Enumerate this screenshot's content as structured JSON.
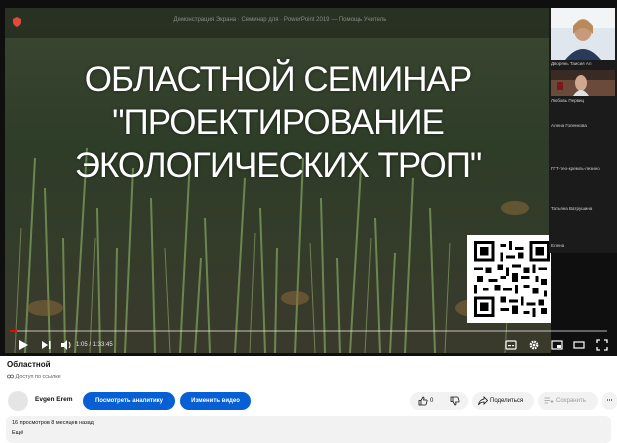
{
  "video": {
    "slide_title_lines": [
      "ОБЛАСТНОЙ СЕМИНАР",
      "\"ПРОЕКТИРОВАНИЕ",
      "ЭКОЛОГИЧЕСКИХ ТРОП\""
    ],
    "top_strip_text": "Демонстрация Экрана · Семинар для · PowerPoint 2019 — Помощь Учитель"
  },
  "participants": [
    {
      "name": "Дворянь Таисия Ал"
    },
    {
      "name": "Любовь Первиц"
    },
    {
      "name": "Алена Голенкова"
    },
    {
      "name": "ГГТ-тео-кремль-лезино"
    },
    {
      "name": "Татьяна Ватрушина"
    },
    {
      "name": "Елена"
    }
  ],
  "player": {
    "time_display": "1:05 / 1:33:45",
    "progress_fraction": 0.012,
    "accent_color": "#ff0000"
  },
  "meta": {
    "title": "Областной",
    "access_label": "Доступ по ссылке",
    "channel_name": "Evgen Erem",
    "analytics_label": "Посмотреть аналитику",
    "edit_label": "Изменить видео",
    "likes": "0",
    "share_label": "Поделиться",
    "save_label": "Сохранить",
    "stats": "16 просмотров  8 месяцев назад",
    "more_label": "Ещё"
  }
}
